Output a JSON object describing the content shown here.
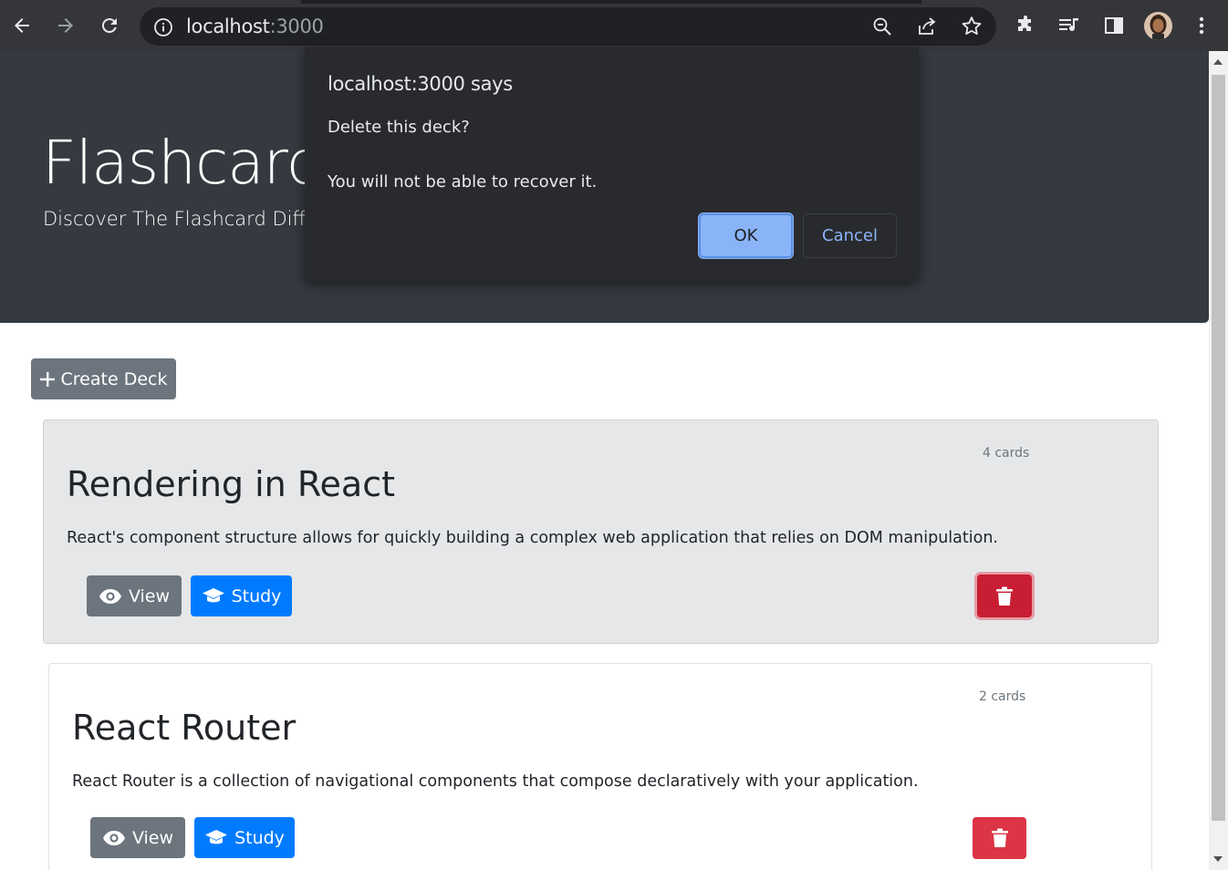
{
  "browser": {
    "url_host": "localhost",
    "url_port": ":3000",
    "icons": [
      "back-arrow-icon",
      "forward-arrow-icon",
      "reload-icon",
      "site-info-icon",
      "zoom-icon",
      "share-icon",
      "bookmark-star-icon",
      "extensions-icon",
      "media-queue-icon",
      "side-panel-icon",
      "profile-avatar",
      "menu-dots-icon"
    ]
  },
  "jumbotron": {
    "title": "Flashcard-",
    "lead": "Discover The Flashcard Differ"
  },
  "actions": {
    "create_deck_label": "Create Deck"
  },
  "decks": [
    {
      "count": "4 cards",
      "title": "Rendering in React",
      "description": "React's component structure allows for quickly building a complex web application that relies on DOM manipulation.",
      "view_label": "View",
      "study_label": "Study"
    },
    {
      "count": "2 cards",
      "title": "React Router",
      "description": "React Router is a collection of navigational components that compose declaratively with your application.",
      "view_label": "View",
      "study_label": "Study"
    }
  ],
  "dialog": {
    "title": "localhost:3000 says",
    "message": "Delete this deck?\n\nYou will not be able to recover it.",
    "ok_label": "OK",
    "cancel_label": "Cancel"
  },
  "colors": {
    "jumbotron_bg": "#343a40",
    "primary": "#007bff",
    "secondary": "#6c757d",
    "danger": "#dc3545",
    "dialog_bg": "#292a2d",
    "dialog_accent": "#8ab4f8"
  }
}
